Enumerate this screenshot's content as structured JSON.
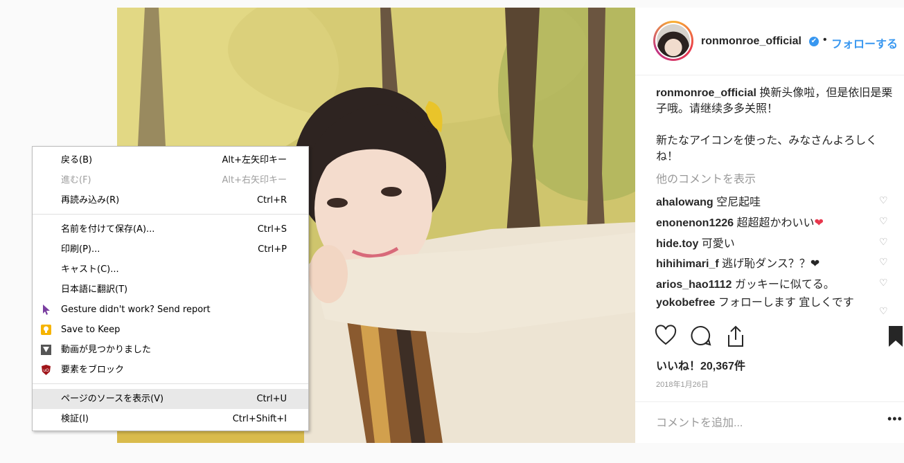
{
  "post": {
    "username": "ronmonroe_official",
    "verified_mark": "✔",
    "separator": "•",
    "follow_label": "フォローする",
    "caption_user": "ronmonroe_official",
    "caption_text": "换新头像啦，但是依旧是栗子哦。请继续多多关照！",
    "caption_text2": "新たなアイコンを使った、みなさんよろしくね！",
    "view_more_comments": "他のコメントを表示",
    "comments": [
      {
        "user": "ahalowang",
        "text": "空尼起哇"
      },
      {
        "user": "enonenon1226",
        "text": "超超超かわいい",
        "emoji": "❤"
      },
      {
        "user": "hide.toy",
        "text": "可愛い"
      },
      {
        "user": "hihihimari_f",
        "text": "逃げ恥ダンス？？❤"
      },
      {
        "user": "arios_hao1112",
        "text": "ガッキーに似てる。"
      },
      {
        "user": "yokobefree",
        "text": "フォローします 宜しくです"
      }
    ],
    "likes_label": "いいね！20,367件",
    "date": "2018年1月26日",
    "add_comment_placeholder": "コメントを追加...",
    "more_options": "•••",
    "icons": {
      "like": "heart-icon",
      "comment": "comment-icon",
      "share": "share-icon",
      "save": "bookmark-icon",
      "comment_like": "heart-outline-icon"
    }
  },
  "context_menu": {
    "items": [
      {
        "label": "戻る(B)",
        "shortcut": "Alt+左矢印キー",
        "enabled": true
      },
      {
        "label": "進む(F)",
        "shortcut": "Alt+右矢印キー",
        "enabled": false
      },
      {
        "label": "再読み込み(R)",
        "shortcut": "Ctrl+R",
        "enabled": true
      },
      {
        "label": "名前を付けて保存(A)...",
        "shortcut": "Ctrl+S",
        "enabled": true
      },
      {
        "label": "印刷(P)...",
        "shortcut": "Ctrl+P",
        "enabled": true
      },
      {
        "label": "キャスト(C)...",
        "shortcut": "",
        "enabled": true
      },
      {
        "label": "日本語に翻訳(T)",
        "shortcut": "",
        "enabled": true
      },
      {
        "label": "Gesture didn't work? Send report",
        "shortcut": "",
        "enabled": true,
        "icon": "cursor-arrow-icon"
      },
      {
        "label": "Save to Keep",
        "shortcut": "",
        "enabled": true,
        "icon": "keep-bulb-icon"
      },
      {
        "label": "動画が見つかりました",
        "shortcut": "",
        "enabled": true,
        "icon": "download-arrow-icon"
      },
      {
        "label": "要素をブロック",
        "shortcut": "",
        "enabled": true,
        "icon": "ublock-shield-icon"
      },
      {
        "label": "ページのソースを表示(V)",
        "shortcut": "Ctrl+U",
        "enabled": true,
        "highlighted": true
      },
      {
        "label": "検証(I)",
        "shortcut": "Ctrl+Shift+I",
        "enabled": true
      }
    ]
  },
  "colors": {
    "accent": "#3897f0",
    "muted": "#999999",
    "ublock": "#a0151a",
    "keep": "#f6b400",
    "like_emoji": "#e8374d"
  }
}
